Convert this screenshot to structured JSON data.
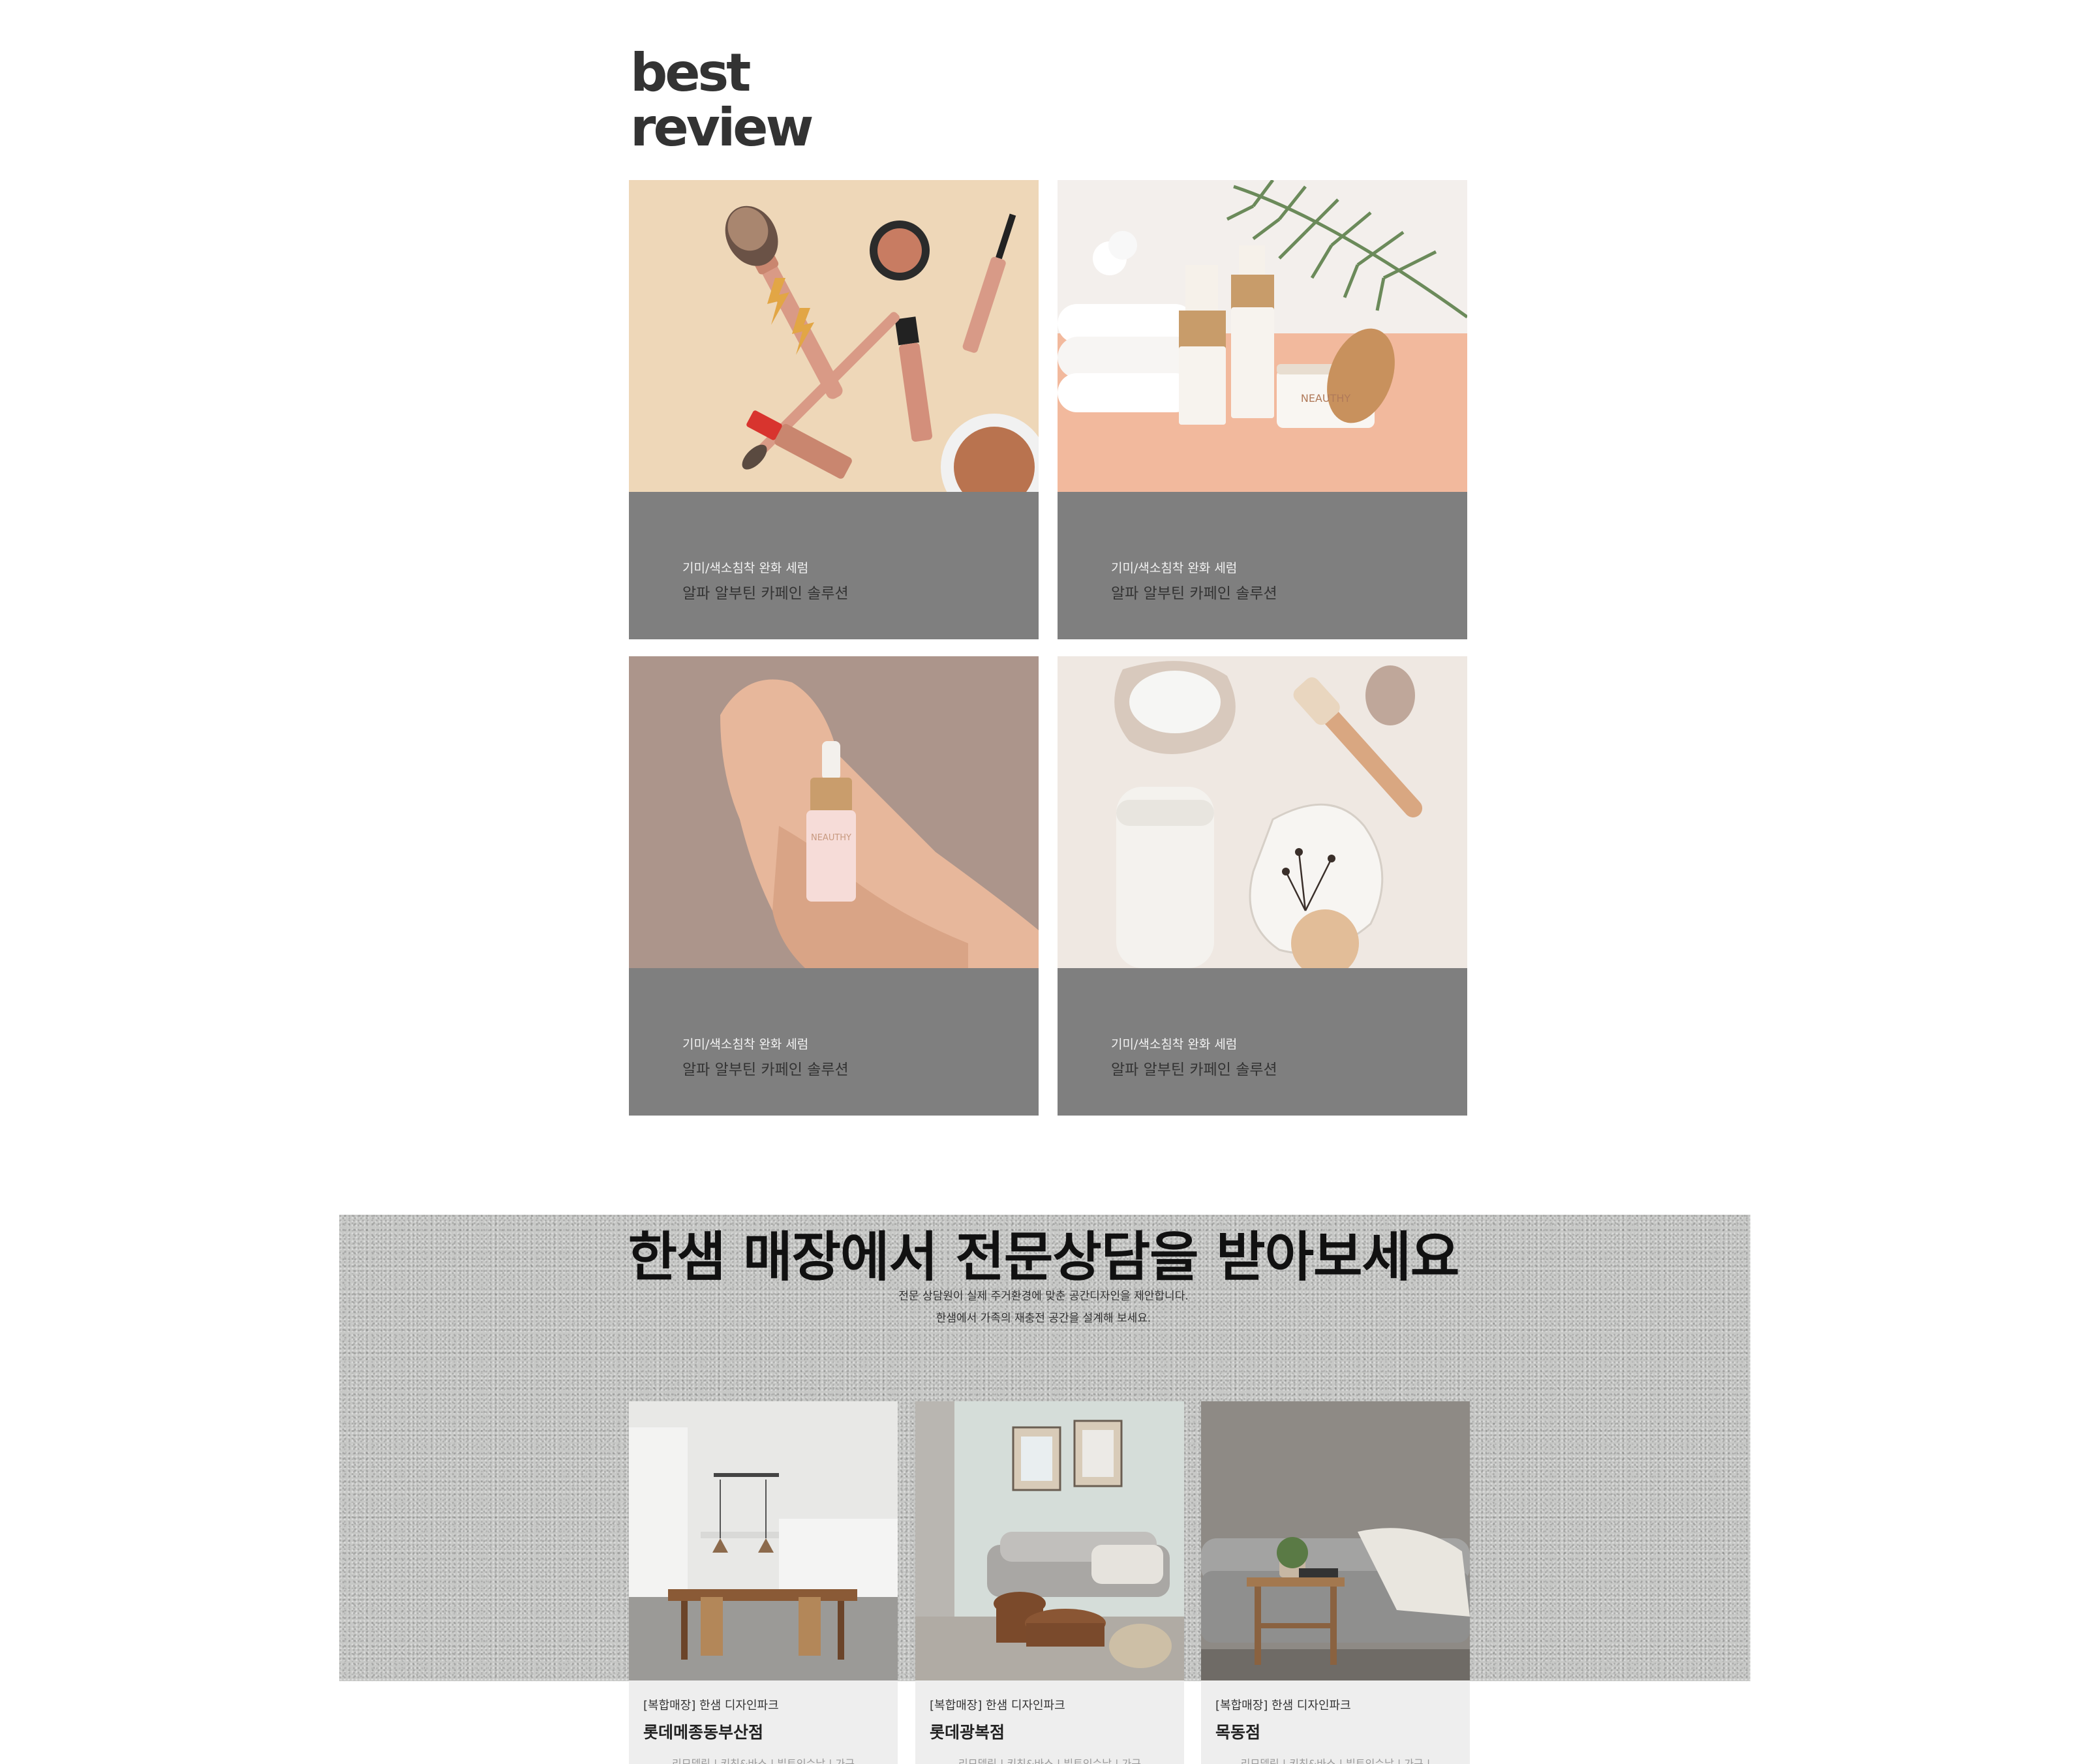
{
  "best_review": {
    "title_line1": "best",
    "title_line2": "review",
    "cards": [
      {
        "subtitle": "기미/색소침착 완화 세럼",
        "title": "알파 알부틴 카페인 솔루션"
      },
      {
        "subtitle": "기미/색소침착 완화 세럼",
        "title": "알파 알부틴 카페인 솔루션"
      },
      {
        "subtitle": "기미/색소침착 완화 세럼",
        "title": "알파 알부틴 카페인 솔루션"
      },
      {
        "subtitle": "기미/색소침착 완화 세럼",
        "title": "알파 알부틴 카페인 솔루션"
      }
    ],
    "product_brand": "NEAUTHY"
  },
  "consult": {
    "heading": "한샘 매장에서 전문상담을 받아보세요",
    "line1": "전문 상담원이 실제 주거환경에 맞춘 공간디자인을 제안합니다.",
    "line2": "한샘에서 가족의 재충전 공간을 설계해 보세요.",
    "stores": [
      {
        "tag": "[복합매장] 한샘 디자인파크",
        "name": "롯데메종동부산점",
        "meta": "리모델링 | 키친&바스 | 빌트인수납 | 가구"
      },
      {
        "tag": "[복합매장] 한샘 디자인파크",
        "name": "롯데광복점",
        "meta": "리모델링 | 키친&바스 | 빌트인수납 | 가구"
      },
      {
        "tag": "[복합매장] 한샘 디자인파크",
        "name": "목동점",
        "meta": "리모델링 | 키친&바스 | 빌트인수납 | 가구 |"
      }
    ]
  },
  "colors": {
    "caption_bg": "#7f7f7f",
    "store_info_bg": "#eeeeee",
    "band_bg": "#c7c8c6"
  }
}
